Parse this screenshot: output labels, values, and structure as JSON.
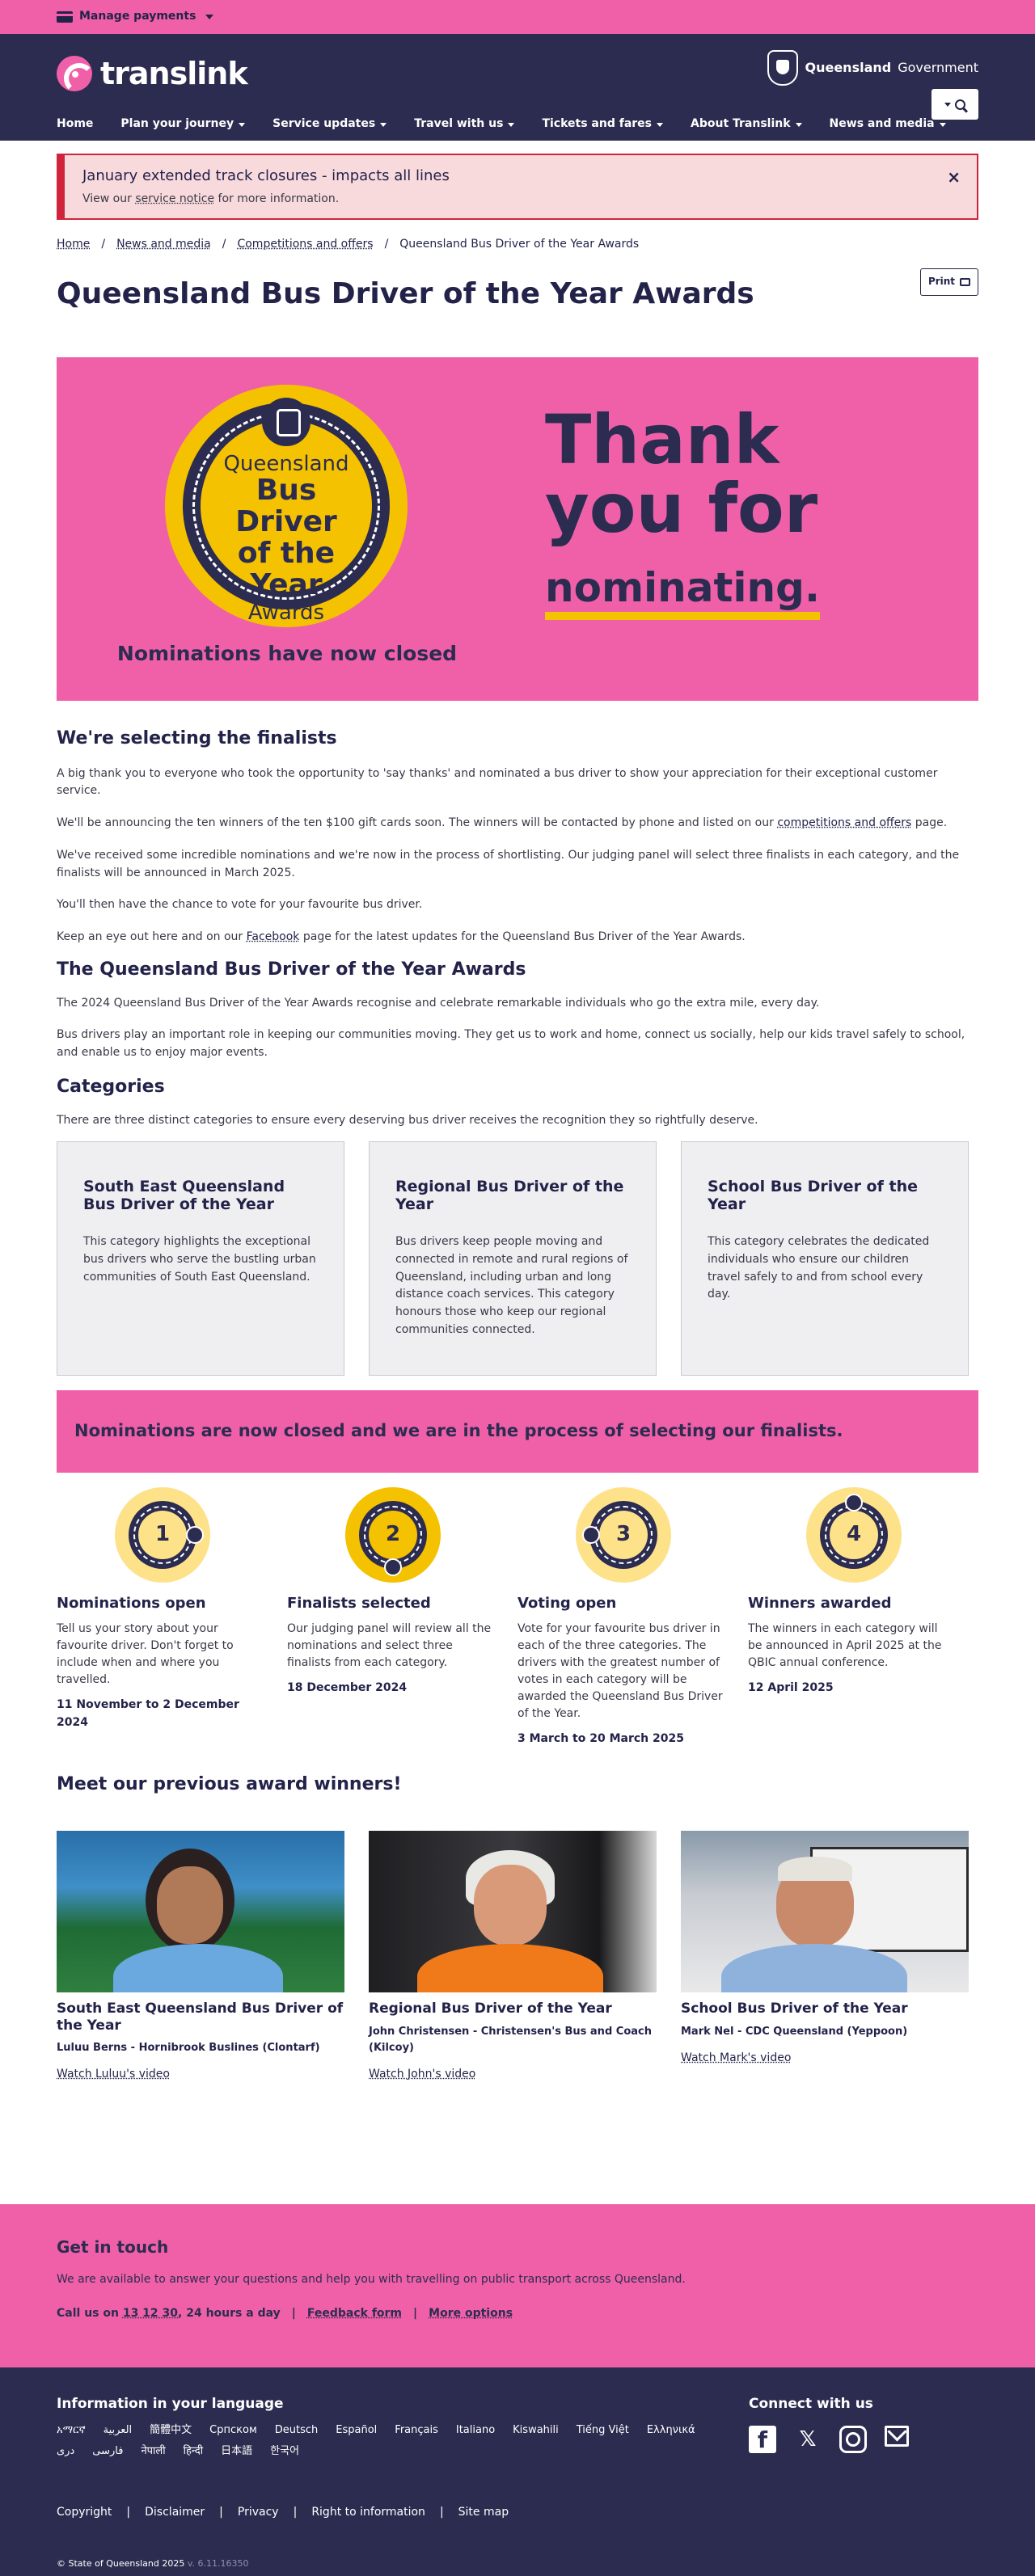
{
  "topbar": {
    "manage_payments": "Manage payments"
  },
  "header": {
    "logo_text": "translink",
    "gov_text_bold": "Queensland",
    "gov_text": "Government",
    "nav": [
      "Home",
      "Plan your journey",
      "Service updates",
      "Travel with us",
      "Tickets and fares",
      "About Translink",
      "News and media"
    ],
    "nav_has_dropdown": [
      false,
      true,
      true,
      true,
      true,
      true,
      true
    ]
  },
  "alert": {
    "title": "January extended track closures - impacts all lines",
    "text_before": "View our ",
    "link": "service notice",
    "text_after": " for more information.",
    "close": "×"
  },
  "breadcrumb": [
    "Home",
    "News and media",
    "Competitions and offers",
    "Queensland Bus Driver of the Year Awards"
  ],
  "page_title": "Queensland Bus Driver of the Year Awards",
  "print_label": "Print",
  "hero": {
    "badge_line1": "Queensland",
    "badge_line2": "Bus Driver",
    "badge_line3": "of the Year",
    "badge_line4": "Awards",
    "closed": "Nominations have now closed",
    "thanks_line1": "Thank",
    "thanks_line2": "you for",
    "thanks_line3": "nominating."
  },
  "selecting": {
    "heading": "We're selecting the finalists",
    "p1": "A big thank you to everyone who took the opportunity to 'say thanks' and nominated a bus driver to show your appreciation for their exceptional customer service.",
    "p2_before": "We'll be announcing the ten winners of the ten $100 gift cards soon. The winners will be contacted by phone and listed on our ",
    "p2_link": "competitions and offers",
    "p2_after": " page.",
    "p3": "We've received some incredible nominations and we're now in the process of shortlisting. Our judging panel will select three finalists in each category, and the finalists will be announced in March 2025.",
    "p4": "You'll then have the chance to vote for your favourite bus driver.",
    "p5_before": "Keep an eye out here and on our ",
    "p5_link": "Facebook",
    "p5_after": " page for the latest updates for the Queensland Bus Driver of the Year Awards."
  },
  "awards": {
    "heading": "The Queensland Bus Driver of the Year Awards",
    "p1": "The 2024 Queensland Bus Driver of the Year Awards recognise and celebrate remarkable individuals who go the extra mile, every day.",
    "p2": "Bus drivers play an important role in keeping our communities moving. They get us to work and home, connect us socially, help our kids travel safely to school, and enable us to enjoy major events."
  },
  "categories": {
    "heading": "Categories",
    "intro": "There are three distinct categories to ensure every deserving bus driver receives the recognition they so rightfully deserve.",
    "items": [
      {
        "title": "South East Queensland Bus Driver of the Year",
        "text": "This category highlights the exceptional bus drivers who serve the bustling urban communities of South East Queensland."
      },
      {
        "title": "Regional Bus Driver of the Year",
        "text": "Bus drivers keep people moving and connected in remote and rural regions of Queensland, including urban and long distance coach services. This category honours those who keep our regional communities connected."
      },
      {
        "title": "School Bus Driver of the Year",
        "text": "This category celebrates the dedicated individuals who ensure our children travel safely to and from school every day."
      }
    ]
  },
  "banner": "Nominations are now closed and we are in the process of selecting our finalists.",
  "steps": [
    {
      "num": "1",
      "title": "Nominations open",
      "text": "Tell us your story about your favourite driver. Don't forget to include when and where you travelled.",
      "date": "11 November to 2 December 2024"
    },
    {
      "num": "2",
      "title": "Finalists selected",
      "text": "Our judging panel will review all the nominations and select three finalists from each category.",
      "date": "18 December 2024"
    },
    {
      "num": "3",
      "title": "Voting open",
      "text": "Vote for your favourite bus driver in each of the three categories. The drivers with the greatest number of votes in each category will be awarded the Queensland Bus Driver of the Year.",
      "date": "3 March to 20 March 2025"
    },
    {
      "num": "4",
      "title": "Winners awarded",
      "text": "The winners in each category will be announced in April 2025 at the QBIC annual conference.",
      "date": "12 April 2025"
    }
  ],
  "winners": {
    "heading": "Meet our previous award winners!",
    "items": [
      {
        "category": "South East Queensland Bus Driver of the Year",
        "name": "Luluu Berns - Hornibrook Buslines (Clontarf)",
        "link": "Watch Luluu's video"
      },
      {
        "category": "Regional Bus Driver of the Year",
        "name": "John Christensen - Christensen's Bus and Coach (Kilcoy)",
        "link": "Watch John's video"
      },
      {
        "category": "School Bus Driver of the Year",
        "name": "Mark Nel - CDC Queensland (Yeppoon)",
        "link": "Watch Mark's video"
      }
    ]
  },
  "contact": {
    "heading": "Get in touch",
    "text": "We are available to answer your questions and help you with travelling on public transport across Queensland.",
    "call_before": "Call us on ",
    "call_number": "13 12 30",
    "call_after": ", 24 hours a day",
    "feedback": "Feedback form",
    "more": "More options"
  },
  "footer": {
    "lang_heading": "Information in your language",
    "languages": [
      "አማርኛ",
      "العربية",
      "簡體中文",
      "Српском",
      "Deutsch",
      "Español",
      "Français",
      "Italiano",
      "Kiswahili",
      "Tiếng Việt",
      "Ελληνικά",
      "دری",
      "فارسی",
      "नेपाली",
      "हिन्दी",
      "日本語",
      "한국어"
    ],
    "connect_heading": "Connect with us",
    "links": [
      "Copyright",
      "Disclaimer",
      "Privacy",
      "Right to information",
      "Site map"
    ],
    "copyright": "© State of Queensland 2025",
    "version": "v. 6.11.16350"
  },
  "colors": {
    "pink": "#f060a8",
    "navy": "#2c2c50",
    "yellow": "#f4c200",
    "alert_red": "#d0243c"
  }
}
